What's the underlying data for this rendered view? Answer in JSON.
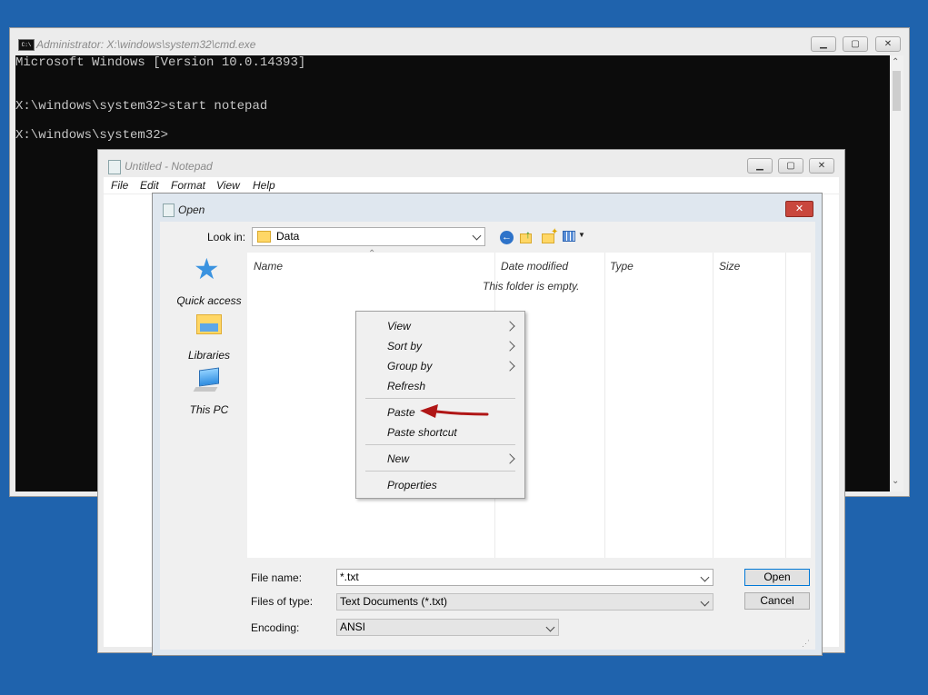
{
  "cmd": {
    "title": "Administrator: X:\\windows\\system32\\cmd.exe",
    "lines": [
      "Microsoft Windows [Version 10.0.14393]",
      "X:\\windows\\system32>start notepad",
      "X:\\windows\\system32>"
    ]
  },
  "notepad": {
    "title": "Untitled - Notepad",
    "menu": [
      "File",
      "Edit",
      "Format",
      "View",
      "Help"
    ]
  },
  "open_dialog": {
    "title": "Open",
    "close_glyph": "✕",
    "look_in_label": "Look in:",
    "look_in_value": "Data",
    "columns": [
      "Name",
      "Date modified",
      "Type",
      "Size"
    ],
    "empty_text": "This folder is empty.",
    "places": [
      "Quick access",
      "Libraries",
      "This PC"
    ],
    "file_name_label": "File name:",
    "file_name_value": "*.txt",
    "files_of_type_label": "Files of type:",
    "files_of_type_value": "Text Documents (*.txt)",
    "encoding_label": "Encoding:",
    "encoding_value": "ANSI",
    "open_button": "Open",
    "cancel_button": "Cancel"
  },
  "context_menu": {
    "items": [
      "View",
      "Sort by",
      "Group by",
      "Refresh",
      "Paste",
      "Paste shortcut",
      "New",
      "Properties"
    ]
  },
  "colors": {
    "desktop": "#1f63ad",
    "arrow": "#b01616",
    "close_button": "#c9473d"
  }
}
